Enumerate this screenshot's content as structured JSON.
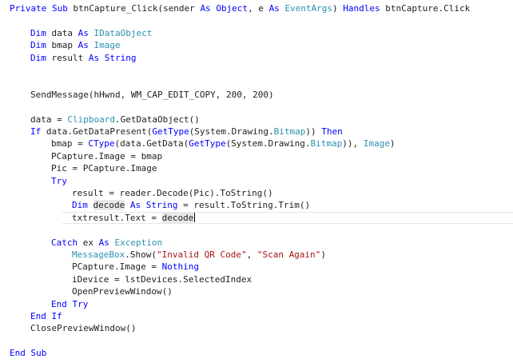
{
  "editor": {
    "partial_top_line": "' ------",
    "caret_line": 17,
    "lines": [
      {
        "indent": 0,
        "tokens": [
          {
            "t": "Private",
            "k": "kw"
          },
          {
            "t": " "
          },
          {
            "t": "Sub",
            "k": "kw"
          },
          {
            "t": " btnCapture_Click(sender "
          },
          {
            "t": "As",
            "k": "kw"
          },
          {
            "t": " "
          },
          {
            "t": "Object",
            "k": "kw"
          },
          {
            "t": ", e "
          },
          {
            "t": "As",
            "k": "kw"
          },
          {
            "t": " "
          },
          {
            "t": "EventArgs",
            "k": "typ"
          },
          {
            "t": ") "
          },
          {
            "t": "Handles",
            "k": "kw"
          },
          {
            "t": " btnCapture.Click"
          }
        ]
      },
      {
        "indent": 0,
        "tokens": []
      },
      {
        "indent": 1,
        "tokens": [
          {
            "t": "Dim",
            "k": "kw"
          },
          {
            "t": " data "
          },
          {
            "t": "As",
            "k": "kw"
          },
          {
            "t": " "
          },
          {
            "t": "IDataObject",
            "k": "typ"
          }
        ]
      },
      {
        "indent": 1,
        "tokens": [
          {
            "t": "Dim",
            "k": "kw"
          },
          {
            "t": " bmap "
          },
          {
            "t": "As",
            "k": "kw"
          },
          {
            "t": " "
          },
          {
            "t": "Image",
            "k": "typ"
          }
        ]
      },
      {
        "indent": 1,
        "tokens": [
          {
            "t": "Dim",
            "k": "kw"
          },
          {
            "t": " result "
          },
          {
            "t": "As",
            "k": "kw"
          },
          {
            "t": " "
          },
          {
            "t": "String",
            "k": "kw"
          }
        ]
      },
      {
        "indent": 0,
        "tokens": []
      },
      {
        "indent": 0,
        "tokens": []
      },
      {
        "indent": 1,
        "tokens": [
          {
            "t": "SendMessage(hHwnd, WM_CAP_EDIT_COPY, 200, 200)"
          }
        ]
      },
      {
        "indent": 0,
        "tokens": []
      },
      {
        "indent": 1,
        "tokens": [
          {
            "t": "data = "
          },
          {
            "t": "Clipboard",
            "k": "typ"
          },
          {
            "t": ".GetDataObject()"
          }
        ]
      },
      {
        "indent": 1,
        "tokens": [
          {
            "t": "If",
            "k": "kw"
          },
          {
            "t": " data.GetDataPresent("
          },
          {
            "t": "GetType",
            "k": "kw"
          },
          {
            "t": "(System.Drawing."
          },
          {
            "t": "Bitmap",
            "k": "typ"
          },
          {
            "t": ")) "
          },
          {
            "t": "Then",
            "k": "kw"
          }
        ]
      },
      {
        "indent": 2,
        "tokens": [
          {
            "t": "bmap = "
          },
          {
            "t": "CType",
            "k": "kw"
          },
          {
            "t": "(data.GetData("
          },
          {
            "t": "GetType",
            "k": "kw"
          },
          {
            "t": "(System.Drawing."
          },
          {
            "t": "Bitmap",
            "k": "typ"
          },
          {
            "t": ")), "
          },
          {
            "t": "Image",
            "k": "typ"
          },
          {
            "t": ")"
          }
        ]
      },
      {
        "indent": 2,
        "tokens": [
          {
            "t": "PCapture.Image = bmap"
          }
        ]
      },
      {
        "indent": 2,
        "tokens": [
          {
            "t": "Pic = PCapture.Image"
          }
        ]
      },
      {
        "indent": 2,
        "tokens": [
          {
            "t": "Try",
            "k": "kw"
          }
        ]
      },
      {
        "indent": 3,
        "tokens": [
          {
            "t": "result = reader.Decode(Pic).ToString()"
          }
        ]
      },
      {
        "indent": 3,
        "tokens": [
          {
            "t": "Dim",
            "k": "kw"
          },
          {
            "t": " "
          },
          {
            "t": "decode",
            "k": "hl"
          },
          {
            "t": " "
          },
          {
            "t": "As",
            "k": "kw"
          },
          {
            "t": " "
          },
          {
            "t": "String",
            "k": "kw"
          },
          {
            "t": " = result.ToString.Trim()"
          }
        ]
      },
      {
        "indent": 3,
        "tokens": [
          {
            "t": "txtresult.Text = "
          },
          {
            "t": "decode",
            "k": "hl"
          }
        ]
      },
      {
        "indent": 0,
        "tokens": []
      },
      {
        "indent": 2,
        "tokens": [
          {
            "t": "Catch",
            "k": "kw"
          },
          {
            "t": " ex "
          },
          {
            "t": "As",
            "k": "kw"
          },
          {
            "t": " "
          },
          {
            "t": "Exception",
            "k": "typ"
          }
        ]
      },
      {
        "indent": 3,
        "tokens": [
          {
            "t": "MessageBox",
            "k": "typ"
          },
          {
            "t": ".Show("
          },
          {
            "t": "\"Invalid QR Code\"",
            "k": "str"
          },
          {
            "t": ", "
          },
          {
            "t": "\"Scan Again\"",
            "k": "str"
          },
          {
            "t": ")"
          }
        ]
      },
      {
        "indent": 3,
        "tokens": [
          {
            "t": "PCapture.Image = "
          },
          {
            "t": "Nothing",
            "k": "kw"
          }
        ]
      },
      {
        "indent": 3,
        "tokens": [
          {
            "t": "iDevice = lstDevices.SelectedIndex"
          }
        ]
      },
      {
        "indent": 3,
        "tokens": [
          {
            "t": "OpenPreviewWindow()"
          }
        ]
      },
      {
        "indent": 2,
        "tokens": [
          {
            "t": "End",
            "k": "kw"
          },
          {
            "t": " "
          },
          {
            "t": "Try",
            "k": "kw"
          }
        ]
      },
      {
        "indent": 1,
        "tokens": [
          {
            "t": "End",
            "k": "kw"
          },
          {
            "t": " "
          },
          {
            "t": "If",
            "k": "kw"
          }
        ]
      },
      {
        "indent": 1,
        "tokens": [
          {
            "t": "ClosePreviewWindow()"
          }
        ]
      },
      {
        "indent": 0,
        "tokens": []
      },
      {
        "indent": 0,
        "tokens": [
          {
            "t": "End",
            "k": "kw"
          },
          {
            "t": " "
          },
          {
            "t": "Sub",
            "k": "kw"
          }
        ]
      }
    ]
  },
  "colors": {
    "keyword": "#0000ff",
    "type": "#2b91af",
    "string": "#a31515",
    "text": "#1e1e1e",
    "reference_highlight": "#e8e8e8"
  }
}
